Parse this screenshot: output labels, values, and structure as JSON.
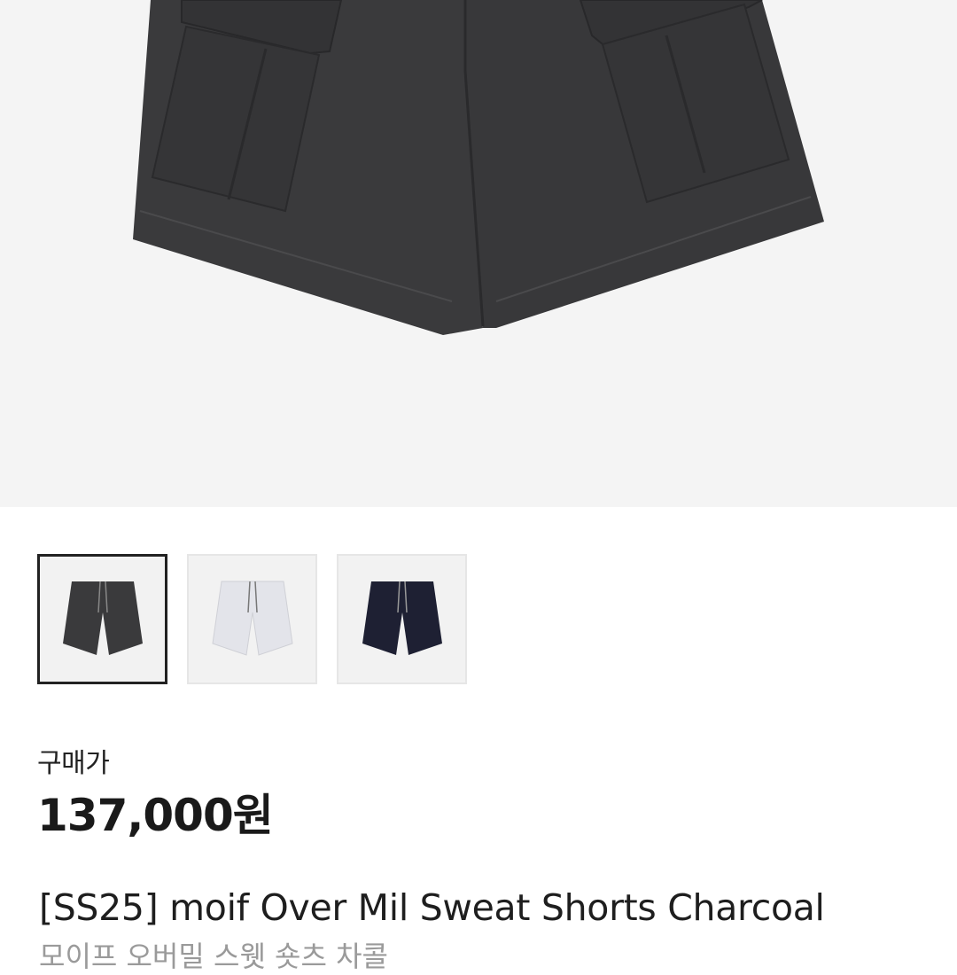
{
  "product": {
    "main_image": "charcoal-cargo-sweat-shorts-closeup",
    "thumbnails": [
      {
        "name": "charcoal",
        "color": "#3a3a3c",
        "selected": true
      },
      {
        "name": "light-gray",
        "color": "#e3e4ea",
        "selected": false
      },
      {
        "name": "navy",
        "color": "#1e2033",
        "selected": false
      }
    ],
    "price_label": "구매가",
    "price": "137,000원",
    "title": "[SS25] moif Over Mil Sweat Shorts Charcoal",
    "subtitle": "모이프 오버밀 스웻 숏츠 차콜"
  },
  "colors": {
    "hero_bg": "#f4f4f4",
    "shorts_charcoal": "#3a3a3c",
    "selected_border": "#222222"
  }
}
